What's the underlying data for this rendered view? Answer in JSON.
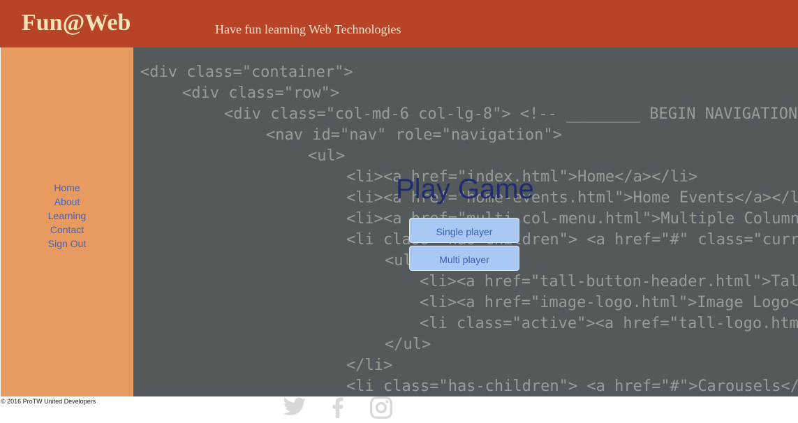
{
  "header": {
    "logo": "Fun@Web",
    "tagline": "Have fun learning Web Technologies"
  },
  "sidebar": {
    "items": [
      {
        "label": "Home"
      },
      {
        "label": "About"
      },
      {
        "label": "Learning"
      },
      {
        "label": "Contact"
      },
      {
        "label": "Sign Out"
      }
    ]
  },
  "main": {
    "title": "Play Game",
    "buttons": [
      {
        "label": "Single player"
      },
      {
        "label": "Multi player"
      }
    ]
  },
  "footer": {
    "copyright": "© 2016 ProTW United Developers",
    "social_icons": [
      "twitter-icon",
      "facebook-icon",
      "instagram-icon"
    ]
  },
  "background_code": [
    "<div class=\"container\">",
    "<div class=\"row\">",
    "<div class=\"col-md-6 col-lg-8\"> <!-- ________ BEGIN NAVIGATION",
    "<nav id=\"nav\" role=\"navigation\">",
    "<ul>",
    "<li><a href=\"index.html\">Home</a></li>",
    "<li><a href=\"home-events.html\">Home Events</a></li>",
    "<li><a href=\"multi-col-menu.html\">Multiple Column Menu",
    "<li class=\"has-children\"> <a href=\"#\" class=\"current\">",
    "<ul>",
    "<li><a href=\"tall-button-header.html\">Tall Butt",
    "<li><a href=\"image-logo.html\">Image Logo</a></",
    "<li class=\"active\"><a href=\"tall-logo.html\">Ta",
    "</ul>",
    "</li>",
    "<li class=\"has-children\"> <a href=\"#\">Carousels</a>"
  ],
  "colors": {
    "header": "#b84428",
    "sidebar": "#e89b60",
    "link": "#3f64c8",
    "title": "#1f2d6e",
    "button": "#a9c8f4"
  }
}
